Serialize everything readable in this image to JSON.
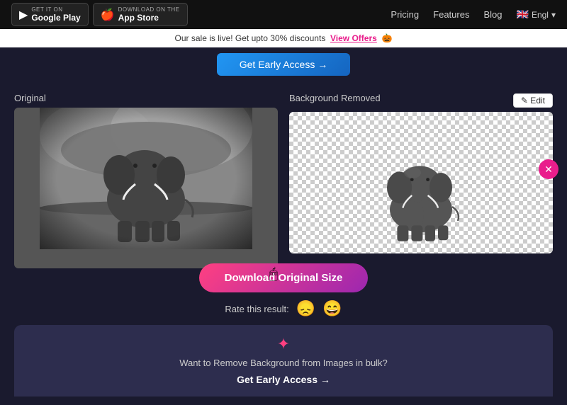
{
  "nav": {
    "google_play_label": "Google Play",
    "google_play_sublabel": "GET IT ON",
    "app_store_label": "App Store",
    "app_store_sublabel": "Download on the",
    "links": [
      "Pricing",
      "Features",
      "Blog"
    ],
    "language": "Engl"
  },
  "sale_banner": {
    "text": "Our sale is live! Get upto 30% discounts",
    "cta": "View Offers",
    "emoji": "🎃"
  },
  "early_access": {
    "btn_label": "Get Early Access →"
  },
  "labels": {
    "original": "Original",
    "background_removed": "Background Removed",
    "edit_btn": "✎ Edit"
  },
  "download": {
    "btn_label": "Download Original Size",
    "rate_label": "Rate this result:"
  },
  "bulk": {
    "icon": "✦",
    "text": "Want to Remove Background from Images in bulk?",
    "cta": "Get Early Access →"
  },
  "emojis": {
    "sad": "😞",
    "happy": "😄"
  }
}
